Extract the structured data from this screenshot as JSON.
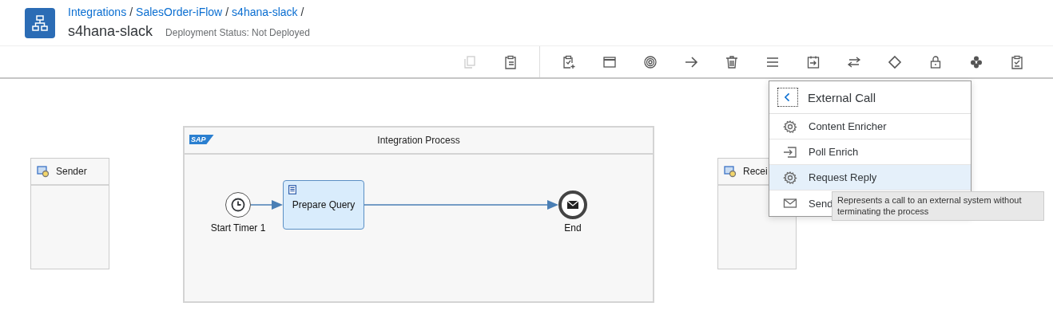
{
  "header": {
    "breadcrumbs": [
      "Integrations",
      "SalesOrder-iFlow",
      "s4hana-slack"
    ],
    "separator": "/",
    "title": "s4hana-slack",
    "status": "Deployment Status: Not Deployed"
  },
  "toolbar": {
    "groups": [
      [
        {
          "kind": "copy",
          "disabled": true
        },
        {
          "kind": "paste",
          "disabled": false
        }
      ],
      [
        {
          "kind": "clipboard-add",
          "disabled": false
        },
        {
          "kind": "window",
          "disabled": false
        },
        {
          "kind": "target",
          "disabled": false
        },
        {
          "kind": "arrow",
          "disabled": false
        },
        {
          "kind": "trash",
          "disabled": false
        },
        {
          "kind": "menu",
          "disabled": false
        },
        {
          "kind": "enter",
          "disabled": false
        },
        {
          "kind": "swap",
          "disabled": false
        },
        {
          "kind": "diamond",
          "disabled": false
        },
        {
          "kind": "lock",
          "disabled": false
        },
        {
          "kind": "cube",
          "disabled": false
        },
        {
          "kind": "clipboard-check",
          "disabled": false
        }
      ]
    ]
  },
  "diagram": {
    "sender": {
      "label": "Sender"
    },
    "process": {
      "title": "Integration Process",
      "logo": "SAP"
    },
    "start": {
      "label": "Start Timer 1"
    },
    "task": {
      "label": "Prepare Query"
    },
    "end": {
      "label": "End"
    },
    "receiver": {
      "label": "Recei"
    }
  },
  "menu": {
    "title": "External Call",
    "items": [
      {
        "kind": "gear",
        "label": "Content Enricher",
        "selected": false
      },
      {
        "kind": "enter",
        "label": "Poll Enrich",
        "selected": false
      },
      {
        "kind": "gear",
        "label": "Request Reply",
        "selected": true
      },
      {
        "kind": "mail",
        "label": "Send",
        "selected": false
      }
    ]
  },
  "tooltip": {
    "text": "Represents a call to an external system without terminating the process"
  }
}
